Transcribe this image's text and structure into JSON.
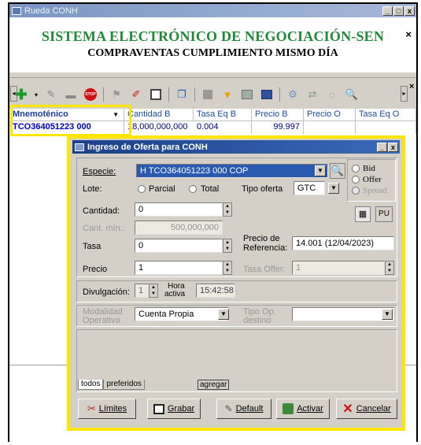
{
  "window": {
    "title": "Rueda CONH",
    "min": "_",
    "max": "□",
    "close": "x"
  },
  "banner": {
    "line1": "SISTEMA ELECTRÓNICO DE NEGOCIACIÓN-SEN",
    "line2": "COMPRAVENTAS CUMPLIMIENTO MISMO DÍA",
    "close": "×"
  },
  "toolbar": {
    "icons": [
      "add-icon",
      "edit-icon",
      "minus-icon",
      "stop-icon",
      "flag-icon",
      "brush-icon",
      "save-icon",
      "copy-icon",
      "square-icon",
      "arrow-icon",
      "image-icon",
      "chart-icon",
      "settings-icon",
      "transfer-icon",
      "refresh-icon",
      "zoom-icon"
    ]
  },
  "grid": {
    "columns": [
      "Mnemoténico",
      "Cantidad B",
      "Tasa Eq B",
      "Precio B",
      "Precio O",
      "Tasa Eq O"
    ],
    "rows": [
      [
        "TCO364051223 000",
        "18,000,000,000",
        "0.004",
        "99.997",
        "",
        ""
      ]
    ]
  },
  "dialog": {
    "title": "Ingreso de Oferta para CONH",
    "especie_label": "Especie:",
    "especie_value": "H TCO364051223 000 COP",
    "lote_label": "Lote:",
    "parcial": "Parcial",
    "total": "Total",
    "tipo_oferta_label": "Tipo oferta",
    "tipo_oferta_value": "GTC",
    "bid": "Bid",
    "offer": "Offer",
    "spread": "Spread",
    "cantidad_label": "Cantidad:",
    "cantidad_value": "0",
    "cant_min_label": "Cant. mín.:",
    "cant_min_value": "500,000,000",
    "pu": "PU",
    "tasa_label": "Tasa",
    "tasa_value": "0",
    "precio_ref_label_1": "Precio de",
    "precio_ref_label_2": "Referencia:",
    "precio_ref_value": "14.001 (12/04/2023)",
    "precio_label": "Precio",
    "precio_value": "1",
    "tasa_offer_label": "Tasa Offer:",
    "tasa_offer_value": "1",
    "divulgacion_label": "Divulgación:",
    "divulgacion_value": "1",
    "hora_label_1": "Hora",
    "hora_label_2": "activa",
    "hora_value": "15:42:58",
    "modalidad_label_1": "Modalidad",
    "modalidad_label_2": "Operativa",
    "modalidad_value": "Cuenta Propia",
    "tipo_op_label_1": "Tipo Op.",
    "tipo_op_label_2": "destino",
    "tipo_op_value": "",
    "tabs": [
      "todos",
      "preferidos"
    ],
    "agregar": "agregar",
    "buttons": {
      "limites": "Límites",
      "grabar": "Grabar",
      "default": "Default",
      "activar": "Activar",
      "cancelar": "Cancelar"
    }
  }
}
